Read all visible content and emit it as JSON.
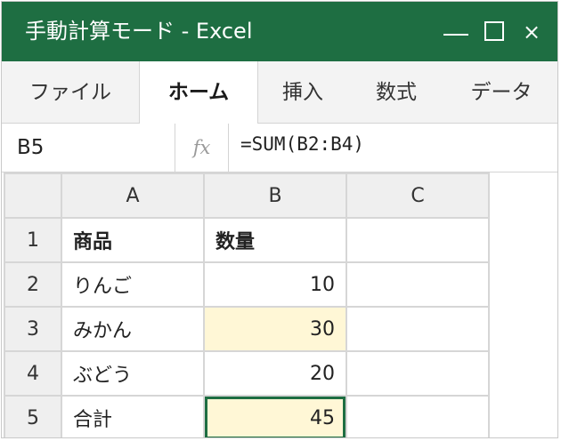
{
  "window": {
    "title": "手動計算モード - Excel",
    "minimize": "minimize",
    "maximize": "maximize",
    "close_glyph": "×"
  },
  "ribbon": {
    "tabs": [
      {
        "label": "ファイル",
        "active": false
      },
      {
        "label": "ホーム",
        "active": true
      },
      {
        "label": "挿入",
        "active": false
      },
      {
        "label": "数式",
        "active": false
      },
      {
        "label": "データ",
        "active": false
      }
    ]
  },
  "formula_bar": {
    "name_box": "B5",
    "fx_label": "fx",
    "formula": "=SUM(B2:B4)"
  },
  "sheet": {
    "columns": [
      "A",
      "B",
      "C"
    ],
    "rows": [
      {
        "num": "1",
        "A": "商品",
        "B": "数量",
        "C": ""
      },
      {
        "num": "2",
        "A": "りんご",
        "B": "10",
        "C": ""
      },
      {
        "num": "3",
        "A": "みかん",
        "B": "30",
        "C": ""
      },
      {
        "num": "4",
        "A": "ぶどう",
        "B": "20",
        "C": ""
      },
      {
        "num": "5",
        "A": "合計",
        "B": "45",
        "C": ""
      }
    ],
    "highlight_color": "#fff7d6",
    "selected_cell": "B5"
  },
  "colors": {
    "title_bar": "#1e6e42",
    "selection_border": "#1e6e42"
  }
}
